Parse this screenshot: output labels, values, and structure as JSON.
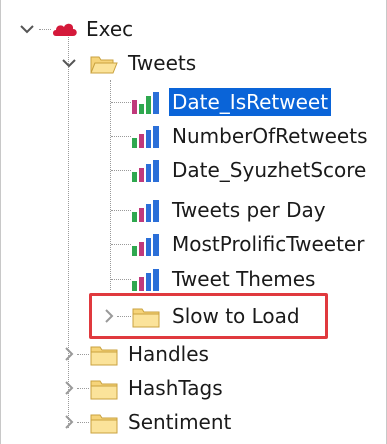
{
  "tree": {
    "root": {
      "label": "Exec",
      "expanded": true,
      "icon": "cloud-icon",
      "icon_color": "#d4193a"
    },
    "tweets_folder": {
      "label": "Tweets",
      "expanded": true
    },
    "reports": [
      {
        "label": "Date_IsRetweet",
        "selected": true
      },
      {
        "label": "NumberOfRetweets",
        "selected": false
      },
      {
        "label": "Date_SyuzhetScore",
        "selected": false
      },
      {
        "label": "Tweets per Day",
        "selected": false
      },
      {
        "label": "MostProlificTweeter",
        "selected": false
      },
      {
        "label": "Tweet Themes",
        "selected": false
      }
    ],
    "slow_folder": {
      "label": "Slow to Load",
      "expanded": false
    },
    "other_folders": [
      {
        "label": "Handles"
      },
      {
        "label": "HashTags"
      },
      {
        "label": "Sentiment"
      }
    ]
  },
  "colors": {
    "selection": "#0a64d8",
    "highlight": "#e0393e",
    "folder": "#f6d47a",
    "chart_bars": [
      "#c0397b",
      "#2fa84f",
      "#2b6fd8"
    ]
  }
}
